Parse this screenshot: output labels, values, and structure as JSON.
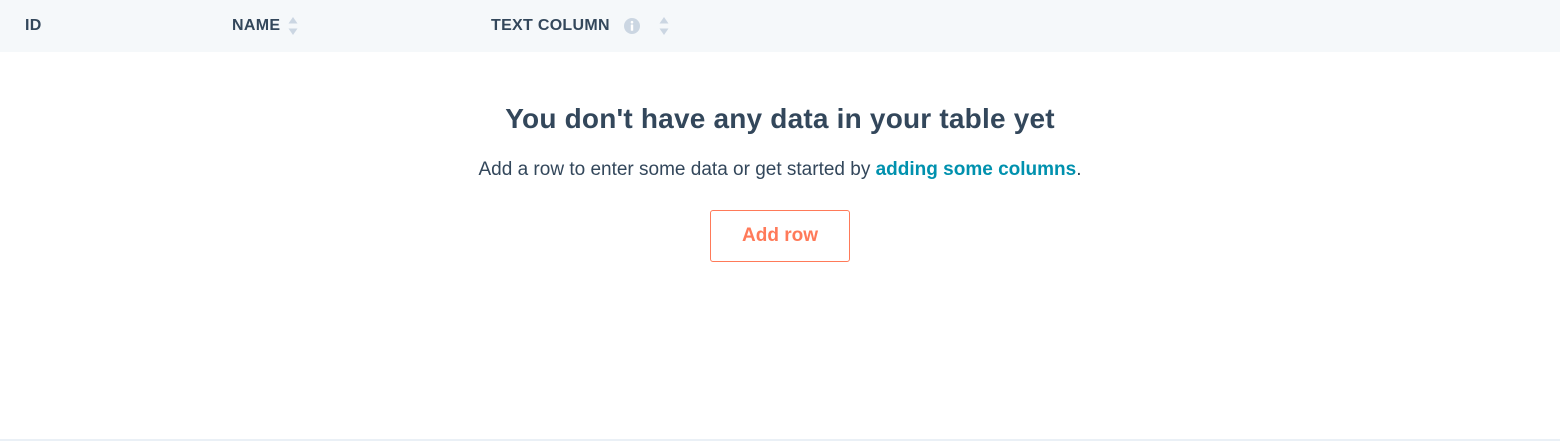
{
  "table": {
    "columns": [
      {
        "label": "ID",
        "sortable": false,
        "info": false
      },
      {
        "label": "NAME",
        "sortable": true,
        "info": false
      },
      {
        "label": "TEXT COLUMN",
        "sortable": true,
        "info": true
      }
    ],
    "icons": {
      "sort": "sort-arrows-icon",
      "info": "info-circle-icon"
    }
  },
  "empty_state": {
    "title": "You don't have any data in your table yet",
    "desc_prefix": "Add a row to enter some data or get started by ",
    "desc_link": "adding some columns",
    "desc_suffix": ".",
    "button_label": "Add row"
  },
  "colors": {
    "header_bg": "#f5f8fa",
    "text": "#33475b",
    "link": "#0091ae",
    "accent": "#ff7a59",
    "icon_muted": "#cbd6e2"
  }
}
